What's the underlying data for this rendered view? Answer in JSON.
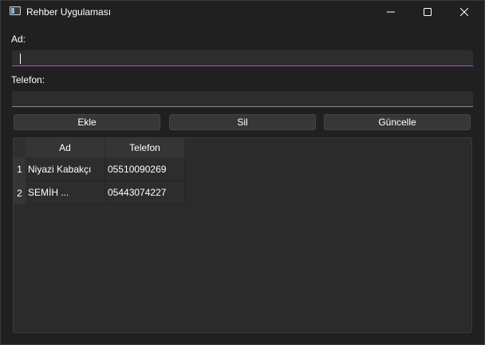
{
  "window": {
    "title": "Rehber Uygulaması",
    "icon": "app-window-icon"
  },
  "colors": {
    "accent": "#a64ee6",
    "background": "#202020",
    "field_bg": "#2d2d2d",
    "button_bg": "#373737"
  },
  "form": {
    "name_label": "Ad:",
    "name_value": "",
    "phone_label": "Telefon:",
    "phone_value": ""
  },
  "buttons": {
    "add": "Ekle",
    "delete": "Sil",
    "update": "Güncelle"
  },
  "table": {
    "columns": [
      "Ad",
      "Telefon"
    ],
    "rows": [
      {
        "index": "1",
        "name": "Niyazi Kabakçı",
        "phone": "05510090269"
      },
      {
        "index": "2",
        "name": "SEMİH ...",
        "phone": "05443074227"
      }
    ]
  }
}
